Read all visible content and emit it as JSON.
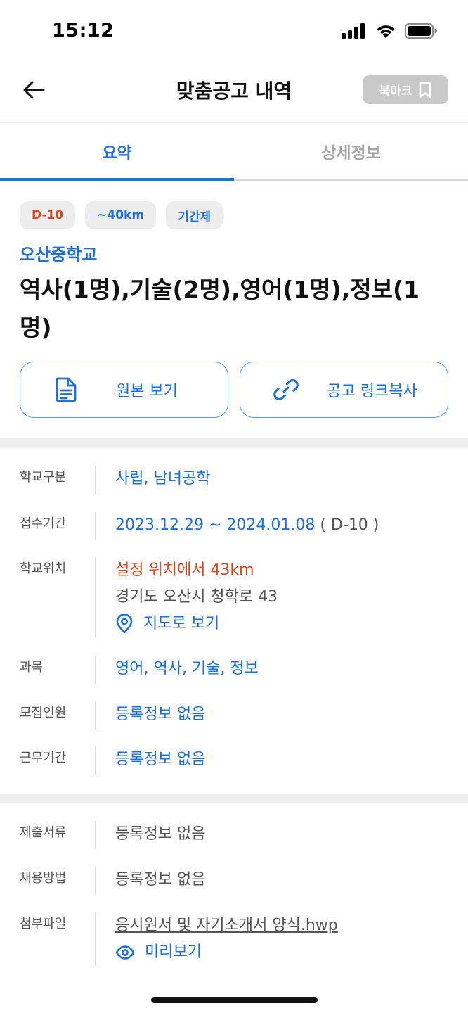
{
  "status_bar": {
    "time": "15:12"
  },
  "header": {
    "title": "맞춤공고 내역",
    "bookmark_label": "북마크"
  },
  "tabs": [
    {
      "label": "요약",
      "active": true
    },
    {
      "label": "상세정보",
      "active": false
    }
  ],
  "chips": {
    "dday": "D-10",
    "distance": "~40km",
    "type": "기간제"
  },
  "posting": {
    "school_name": "오산중학교",
    "title": "역사(1명),기술(2명),영어(1명),정보(1명)"
  },
  "actions": {
    "original_label": "원본 보기",
    "copy_link_label": "공고 링크복사"
  },
  "info": {
    "school_type_label": "학교구분",
    "school_type_value": "사립, 남녀공학",
    "period_label": "접수기간",
    "period_value": "2023.12.29 ~ 2024.01.08",
    "period_dday": "( D-10 )",
    "location_label": "학교위치",
    "location_distance": "설정 위치에서 43km",
    "location_address": "경기도 오산시 청학로 43",
    "location_map_label": "지도로 보기",
    "subjects_label": "과목",
    "subjects_value": "영어, 역사, 기술, 정보",
    "recruit_label": "모집인원",
    "recruit_value": "등록정보 없음",
    "work_period_label": "근무기간",
    "work_period_value": "등록정보 없음"
  },
  "extra": {
    "documents_label": "제출서류",
    "documents_value": "등록정보 없음",
    "hiring_method_label": "채용방법",
    "hiring_method_value": "등록정보 없음",
    "attachment_label": "첨부파일",
    "attachment_file": "응시원서 및 자기소개서 양식.hwp",
    "attachment_preview_label": "미리보기"
  },
  "colors": {
    "accent": "#1f6fd6",
    "dday": "#d9481c",
    "chip_bg": "#ededed",
    "bookmark_bg": "#c9c9c9"
  },
  "icons": {
    "back": "arrow-left-icon",
    "bookmark": "bookmark-icon",
    "original": "document-icon",
    "copy_link": "link-icon",
    "map": "location-pin-icon",
    "preview": "eye-icon"
  }
}
